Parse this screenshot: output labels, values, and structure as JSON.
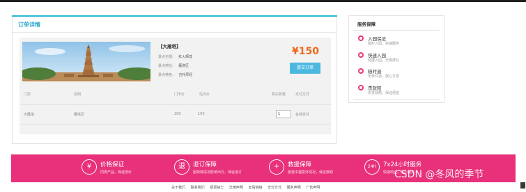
{
  "order": {
    "title": "订单详情",
    "attraction_name": "【大雁塔】",
    "info": [
      {
        "key": "景点主题:",
        "value": "红火辉煌"
      },
      {
        "key": "景点地址:",
        "value": "雁塔区"
      },
      {
        "key": "景点特色:",
        "value": "古朴厚轻"
      }
    ],
    "price": "¥150",
    "submit_label": "提交订单",
    "table": {
      "headers": [
        "门票",
        "说明",
        "门市价",
        "站内价",
        "购买数量",
        "支付方式"
      ],
      "row": {
        "ticket": "大雁塔",
        "desc": "雁塔区",
        "market_price": "200",
        "site_price": "150",
        "quantity": "1",
        "payment": "在线支付"
      }
    }
  },
  "service": {
    "title": "服务保障",
    "items": [
      {
        "title": "入园保证",
        "desc": "极时入园，快速服务"
      },
      {
        "title": "快速入园",
        "desc": "便捷入园，无需排队"
      },
      {
        "title": "随时退",
        "desc": "无条件退，放心订票"
      },
      {
        "title": "贵就赔",
        "desc": "买贵就赔，保证便宜"
      }
    ]
  },
  "features": [
    {
      "icon": "yen-icon",
      "glyph": "¥",
      "title": "价格保证",
      "desc": "同类产品，保证低价"
    },
    {
      "icon": "refund-icon",
      "glyph": "退",
      "title": "退订保障",
      "desc": "因特殊情况影响出行，保证退订"
    },
    {
      "icon": "rescue-icon",
      "glyph": "+",
      "title": "救援保障",
      "desc": "旅途中遇意外情况，保证救助"
    },
    {
      "icon": "24h-icon",
      "glyph": "24H",
      "title": "7x24小时服务",
      "desc": "快速响应，贴心服务"
    }
  ],
  "watermark": "CSDN @冬风的季节",
  "footer": [
    "关于我们",
    "联系我们",
    "招贤纳士",
    "法律声明",
    "友情链接",
    "支付方式",
    "服务声明",
    "广告声明"
  ],
  "colors": {
    "accent": "#2ab7d4",
    "price": "#f06a1c",
    "button": "#4cb8e0",
    "band": "#e8317a"
  }
}
